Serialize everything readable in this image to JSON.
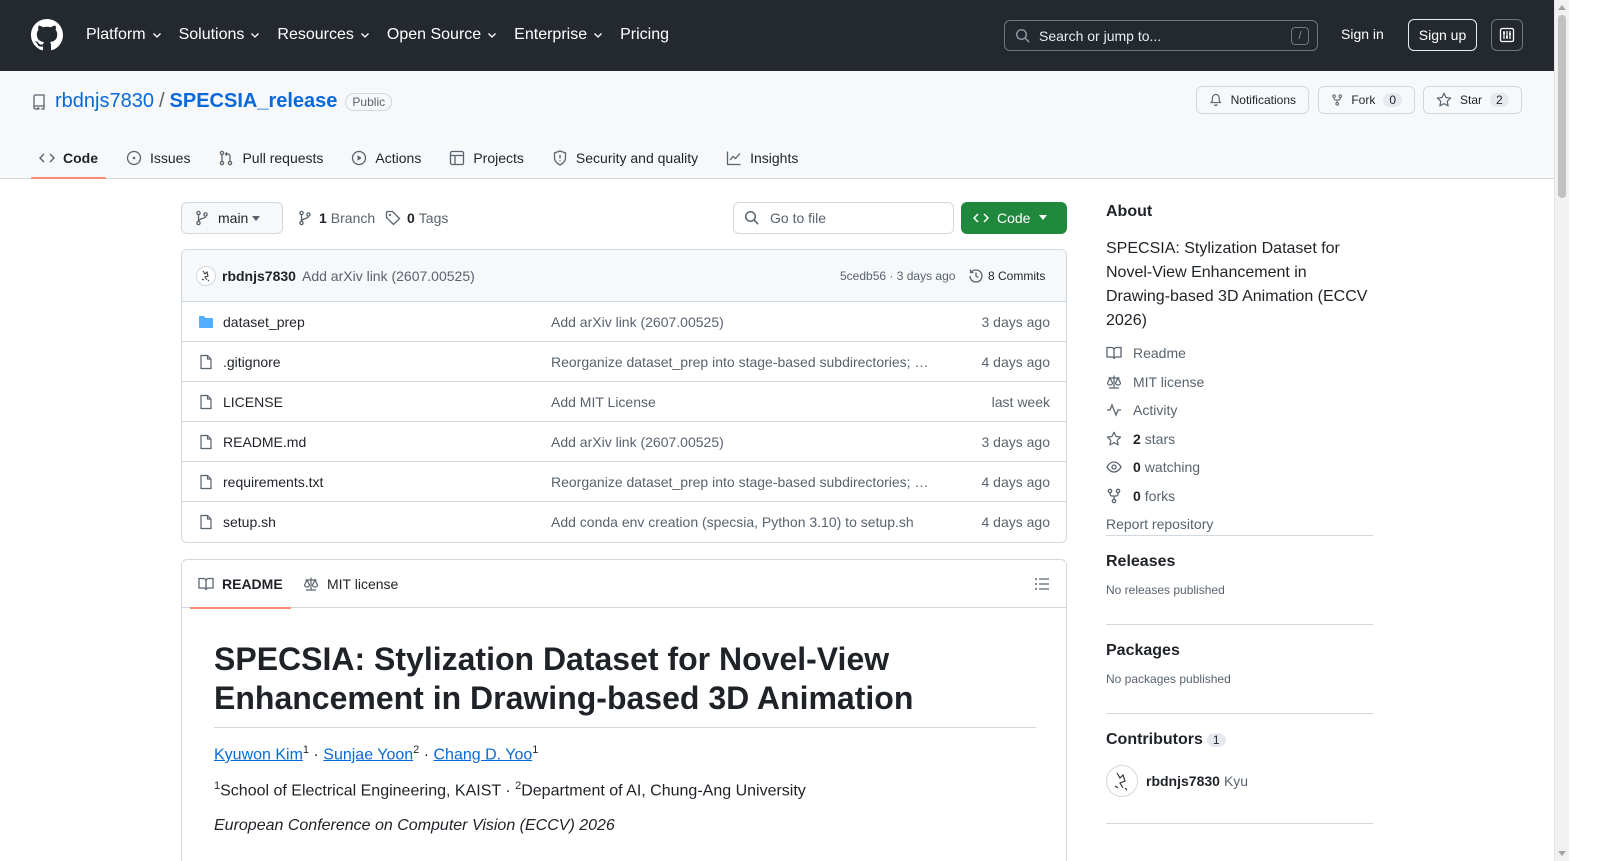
{
  "header": {
    "nav": [
      "Platform",
      "Solutions",
      "Resources",
      "Open Source",
      "Enterprise",
      "Pricing"
    ],
    "search_placeholder": "Search or jump to...",
    "search_shortcut": "/",
    "sign_in": "Sign in",
    "sign_up": "Sign up"
  },
  "repo": {
    "owner": "rbdnjs7830",
    "separator": "/",
    "name": "SPECSIA_release",
    "visibility": "Public",
    "notifications_label": "Notifications",
    "fork_label": "Fork",
    "fork_count": "0",
    "star_label": "Star",
    "star_count": "2"
  },
  "tabs": [
    "Code",
    "Issues",
    "Pull requests",
    "Actions",
    "Projects",
    "Security and quality",
    "Insights"
  ],
  "toolbar": {
    "branch": "main",
    "branch_count": "1",
    "branch_label": "Branch",
    "tag_count": "0",
    "tag_label": "Tags",
    "goto_placeholder": "Go to file",
    "code_button": "Code"
  },
  "latest_commit": {
    "author": "rbdnjs7830",
    "message": "Add arXiv link (2607.00525)",
    "meta": "5cedb56 · 3 days ago",
    "commits": "8 Commits"
  },
  "files": [
    {
      "type": "folder",
      "name": "dataset_prep",
      "message": "Add arXiv link (2607.00525)",
      "date": "3 days ago"
    },
    {
      "type": "file",
      "name": ".gitignore",
      "message": "Reorganize dataset_prep into stage-based subdirectories; r…",
      "date": "4 days ago"
    },
    {
      "type": "file",
      "name": "LICENSE",
      "message": "Add MIT License",
      "date": "last week"
    },
    {
      "type": "file",
      "name": "README.md",
      "message": "Add arXiv link (2607.00525)",
      "date": "3 days ago"
    },
    {
      "type": "file",
      "name": "requirements.txt",
      "message": "Reorganize dataset_prep into stage-based subdirectories; r…",
      "date": "4 days ago"
    },
    {
      "type": "file",
      "name": "setup.sh",
      "message": "Add conda env creation (specsia, Python 3.10) to setup.sh",
      "date": "4 days ago"
    }
  ],
  "readme": {
    "tab_readme": "README",
    "tab_license": "MIT license",
    "title": "SPECSIA: Stylization Dataset for Novel-View Enhancement in Drawing-based 3D Animation",
    "authors": [
      {
        "name": "Kyuwon Kim",
        "sup": "1"
      },
      {
        "name": "Sunjae Yoon",
        "sup": "2"
      },
      {
        "name": "Chang D. Yoo",
        "sup": "1"
      }
    ],
    "author_sep": " · ",
    "affil1_sup": "1",
    "affil1": "School of Electrical Engineering, KAIST · ",
    "affil2_sup": "2",
    "affil2": "Department of AI, Chung-Ang University",
    "venue": "European Conference on Computer Vision (ECCV) 2026"
  },
  "sidebar": {
    "about_title": "About",
    "description": "SPECSIA: Stylization Dataset for Novel-View Enhancement in Drawing-based 3D Animation (ECCV 2026)",
    "readme": "Readme",
    "license": "MIT license",
    "activity": "Activity",
    "stars_count": "2",
    "stars_label": "stars",
    "watching_count": "0",
    "watching_label": "watching",
    "forks_count": "0",
    "forks_label": "forks",
    "report": "Report repository",
    "releases_title": "Releases",
    "releases_sub": "No releases published",
    "packages_title": "Packages",
    "packages_sub": "No packages published",
    "contributors_title": "Contributors",
    "contributors_count": "1",
    "contributor_login": "rbdnjs7830",
    "contributor_name": "Kyu"
  },
  "colors": {
    "header_bg": "#24292f",
    "link": "#0969da",
    "primary_button": "#1f883d",
    "active_tab_underline": "#fd8c73"
  }
}
